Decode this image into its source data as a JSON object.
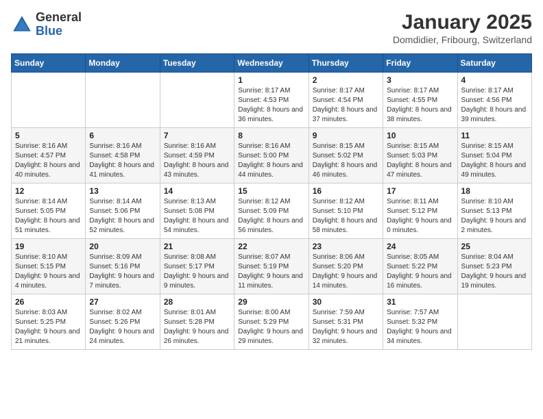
{
  "header": {
    "logo_general": "General",
    "logo_blue": "Blue",
    "month_title": "January 2025",
    "location": "Domdidier, Fribourg, Switzerland"
  },
  "days_of_week": [
    "Sunday",
    "Monday",
    "Tuesday",
    "Wednesday",
    "Thursday",
    "Friday",
    "Saturday"
  ],
  "weeks": [
    [
      {
        "day": "",
        "info": ""
      },
      {
        "day": "",
        "info": ""
      },
      {
        "day": "",
        "info": ""
      },
      {
        "day": "1",
        "info": "Sunrise: 8:17 AM\nSunset: 4:53 PM\nDaylight: 8 hours and 36 minutes."
      },
      {
        "day": "2",
        "info": "Sunrise: 8:17 AM\nSunset: 4:54 PM\nDaylight: 8 hours and 37 minutes."
      },
      {
        "day": "3",
        "info": "Sunrise: 8:17 AM\nSunset: 4:55 PM\nDaylight: 8 hours and 38 minutes."
      },
      {
        "day": "4",
        "info": "Sunrise: 8:17 AM\nSunset: 4:56 PM\nDaylight: 8 hours and 39 minutes."
      }
    ],
    [
      {
        "day": "5",
        "info": "Sunrise: 8:16 AM\nSunset: 4:57 PM\nDaylight: 8 hours and 40 minutes."
      },
      {
        "day": "6",
        "info": "Sunrise: 8:16 AM\nSunset: 4:58 PM\nDaylight: 8 hours and 41 minutes."
      },
      {
        "day": "7",
        "info": "Sunrise: 8:16 AM\nSunset: 4:59 PM\nDaylight: 8 hours and 43 minutes."
      },
      {
        "day": "8",
        "info": "Sunrise: 8:16 AM\nSunset: 5:00 PM\nDaylight: 8 hours and 44 minutes."
      },
      {
        "day": "9",
        "info": "Sunrise: 8:15 AM\nSunset: 5:02 PM\nDaylight: 8 hours and 46 minutes."
      },
      {
        "day": "10",
        "info": "Sunrise: 8:15 AM\nSunset: 5:03 PM\nDaylight: 8 hours and 47 minutes."
      },
      {
        "day": "11",
        "info": "Sunrise: 8:15 AM\nSunset: 5:04 PM\nDaylight: 8 hours and 49 minutes."
      }
    ],
    [
      {
        "day": "12",
        "info": "Sunrise: 8:14 AM\nSunset: 5:05 PM\nDaylight: 8 hours and 51 minutes."
      },
      {
        "day": "13",
        "info": "Sunrise: 8:14 AM\nSunset: 5:06 PM\nDaylight: 8 hours and 52 minutes."
      },
      {
        "day": "14",
        "info": "Sunrise: 8:13 AM\nSunset: 5:08 PM\nDaylight: 8 hours and 54 minutes."
      },
      {
        "day": "15",
        "info": "Sunrise: 8:12 AM\nSunset: 5:09 PM\nDaylight: 8 hours and 56 minutes."
      },
      {
        "day": "16",
        "info": "Sunrise: 8:12 AM\nSunset: 5:10 PM\nDaylight: 8 hours and 58 minutes."
      },
      {
        "day": "17",
        "info": "Sunrise: 8:11 AM\nSunset: 5:12 PM\nDaylight: 9 hours and 0 minutes."
      },
      {
        "day": "18",
        "info": "Sunrise: 8:10 AM\nSunset: 5:13 PM\nDaylight: 9 hours and 2 minutes."
      }
    ],
    [
      {
        "day": "19",
        "info": "Sunrise: 8:10 AM\nSunset: 5:15 PM\nDaylight: 9 hours and 4 minutes."
      },
      {
        "day": "20",
        "info": "Sunrise: 8:09 AM\nSunset: 5:16 PM\nDaylight: 9 hours and 7 minutes."
      },
      {
        "day": "21",
        "info": "Sunrise: 8:08 AM\nSunset: 5:17 PM\nDaylight: 9 hours and 9 minutes."
      },
      {
        "day": "22",
        "info": "Sunrise: 8:07 AM\nSunset: 5:19 PM\nDaylight: 9 hours and 11 minutes."
      },
      {
        "day": "23",
        "info": "Sunrise: 8:06 AM\nSunset: 5:20 PM\nDaylight: 9 hours and 14 minutes."
      },
      {
        "day": "24",
        "info": "Sunrise: 8:05 AM\nSunset: 5:22 PM\nDaylight: 9 hours and 16 minutes."
      },
      {
        "day": "25",
        "info": "Sunrise: 8:04 AM\nSunset: 5:23 PM\nDaylight: 9 hours and 19 minutes."
      }
    ],
    [
      {
        "day": "26",
        "info": "Sunrise: 8:03 AM\nSunset: 5:25 PM\nDaylight: 9 hours and 21 minutes."
      },
      {
        "day": "27",
        "info": "Sunrise: 8:02 AM\nSunset: 5:26 PM\nDaylight: 9 hours and 24 minutes."
      },
      {
        "day": "28",
        "info": "Sunrise: 8:01 AM\nSunset: 5:28 PM\nDaylight: 9 hours and 26 minutes."
      },
      {
        "day": "29",
        "info": "Sunrise: 8:00 AM\nSunset: 5:29 PM\nDaylight: 9 hours and 29 minutes."
      },
      {
        "day": "30",
        "info": "Sunrise: 7:59 AM\nSunset: 5:31 PM\nDaylight: 9 hours and 32 minutes."
      },
      {
        "day": "31",
        "info": "Sunrise: 7:57 AM\nSunset: 5:32 PM\nDaylight: 9 hours and 34 minutes."
      },
      {
        "day": "",
        "info": ""
      }
    ]
  ]
}
